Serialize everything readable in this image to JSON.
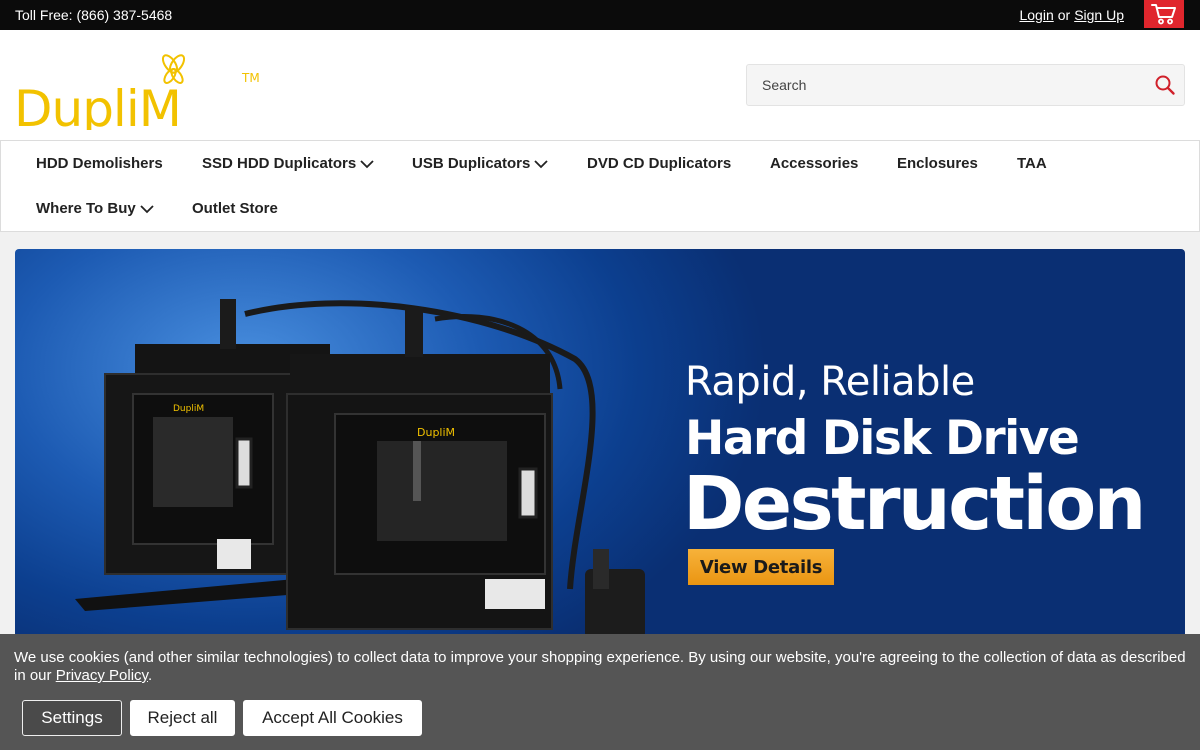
{
  "topbar": {
    "phone": "Toll Free: (866) 387-5468",
    "login": "Login",
    "or": "or",
    "signup": "Sign Up"
  },
  "header": {
    "logo_text": "DupliM",
    "logo_tm": "TM",
    "search_placeholder": "Search"
  },
  "nav": {
    "items": [
      {
        "label": "HDD Demolishers"
      },
      {
        "label": "SSD HDD Duplicators"
      },
      {
        "label": "USB Duplicators"
      },
      {
        "label": "DVD CD Duplicators"
      },
      {
        "label": "Accessories"
      },
      {
        "label": "Enclosures"
      },
      {
        "label": "TAA"
      },
      {
        "label": "Where To Buy"
      },
      {
        "label": "Outlet Store"
      }
    ]
  },
  "banner": {
    "line1": "Rapid, Reliable",
    "line2": "Hard Disk Drive",
    "line3": "Destruction",
    "cta": "View Details",
    "machine_brand": "DupliM"
  },
  "cookie": {
    "message_pre": "We use cookies (and other similar technologies) to collect data to improve your shopping experience. By using our website, you're agreeing to the collection of data as described in our ",
    "privacy_link": "Privacy Policy",
    "message_post": ".",
    "settings": "Settings",
    "reject": "Reject all",
    "accept": "Accept All Cookies"
  },
  "colors": {
    "logo": "#f2c200",
    "cart": "#e0262d",
    "cta": "#f0a527",
    "banner": "#1d5bb3"
  }
}
